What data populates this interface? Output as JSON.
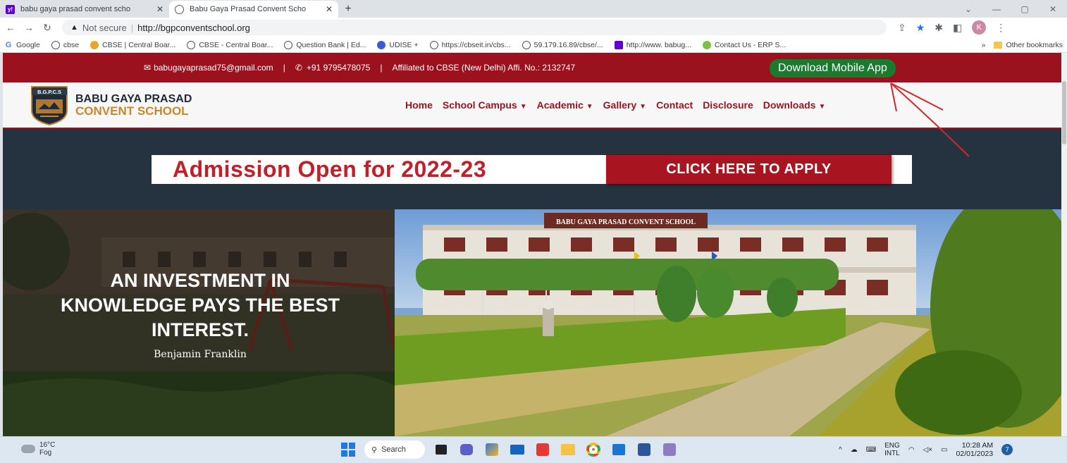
{
  "browser": {
    "tabs": [
      {
        "title": "babu gaya prasad convent scho",
        "active": false,
        "favicon": "yahoo-icon"
      },
      {
        "title": "Babu Gaya Prasad Convent Scho",
        "active": true,
        "favicon": "globe-icon"
      }
    ],
    "address": {
      "security": "Not secure",
      "url": "http://bgpconventschool.org"
    },
    "profile_initial": "K",
    "bookmarks": [
      {
        "label": "Google",
        "icon": "google-icon"
      },
      {
        "label": "cbse",
        "icon": "globe-icon"
      },
      {
        "label": "CBSE | Central Boar...",
        "icon": "cbse-icon"
      },
      {
        "label": "CBSE - Central Boar...",
        "icon": "globe-icon"
      },
      {
        "label": "Question Bank | Ed...",
        "icon": "globe-icon"
      },
      {
        "label": "UDISE +",
        "icon": "udise-icon"
      },
      {
        "label": "https://cbseit.in/cbs...",
        "icon": "globe-icon"
      },
      {
        "label": "59.179.16.89/cbse/...",
        "icon": "globe-icon"
      },
      {
        "label": "http://www. babug...",
        "icon": "yahoo-icon"
      },
      {
        "label": "Contact Us - ERP S...",
        "icon": "erp-icon"
      }
    ],
    "other_bookmarks": "Other bookmarks",
    "overflow": "»"
  },
  "site": {
    "topbar": {
      "email": "babugayaprasad75@gmail.com",
      "phone": "+91 9795478075",
      "affiliation": "Affiliated to CBSE (New Delhi) Affi. No.: 2132747",
      "separator": "|",
      "download_app": "Download Mobile App"
    },
    "brand": {
      "logo_text": "B.G.P.C.S",
      "line1": "BABU GAYA PRASAD",
      "line2": "CONVENT SCHOOL"
    },
    "menu": [
      {
        "label": "Home",
        "dropdown": false
      },
      {
        "label": "School Campus",
        "dropdown": true
      },
      {
        "label": "Academic",
        "dropdown": true
      },
      {
        "label": "Gallery",
        "dropdown": true
      },
      {
        "label": "Contact",
        "dropdown": false
      },
      {
        "label": "Disclosure",
        "dropdown": false
      },
      {
        "label": "Downloads",
        "dropdown": true
      }
    ],
    "banner": {
      "admission": "Admission Open for 2022-23",
      "apply": "CLICK HERE TO APPLY"
    },
    "hero": {
      "quote": "AN INVESTMENT IN KNOWLEDGE PAYS THE BEST INTEREST.",
      "author": "Benjamin Franklin",
      "building_sign": "BABU GAYA PRASAD CONVENT SCHOOL"
    },
    "colors": {
      "primary": "#9b111e",
      "accent_gold": "#c8862f",
      "dark_bg": "#253341",
      "app_button": "#1a7a2e"
    }
  },
  "taskbar": {
    "weather_temp": "16°C",
    "weather_desc": "Fog",
    "search": "Search",
    "lang1": "ENG",
    "lang2": "INTL",
    "time": "10:28 AM",
    "date": "02/01/2023",
    "notifications": "7"
  }
}
